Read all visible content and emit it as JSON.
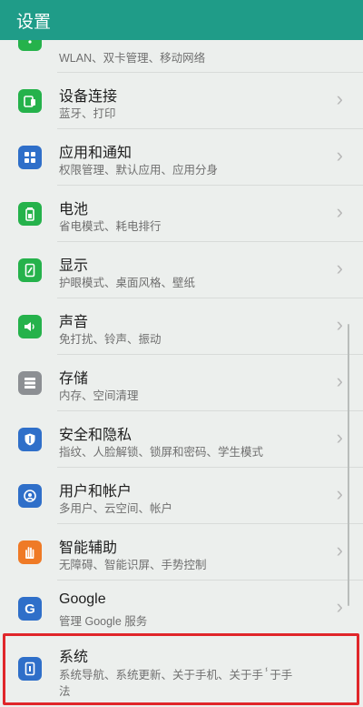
{
  "header": {
    "title": "设置"
  },
  "partial_top": {
    "subtitle": "WLAN、双卡管理、移动网络"
  },
  "items": [
    {
      "title": "设备连接",
      "subtitle": "蓝牙、打印"
    },
    {
      "title": "应用和通知",
      "subtitle": "权限管理、默认应用、应用分身"
    },
    {
      "title": "电池",
      "subtitle": "省电模式、耗电排行"
    },
    {
      "title": "显示",
      "subtitle": "护眼模式、桌面风格、壁纸"
    },
    {
      "title": "声音",
      "subtitle": "免打扰、铃声、振动"
    },
    {
      "title": "存储",
      "subtitle": "内存、空间清理"
    },
    {
      "title": "安全和隐私",
      "subtitle": "指纹、人脸解锁、锁屏和密码、学生模式"
    },
    {
      "title": "用户和帐户",
      "subtitle": "多用户、云空间、帐户"
    },
    {
      "title": "智能辅助",
      "subtitle": "无障碍、智能识屏、手势控制"
    },
    {
      "title": "Google",
      "subtitle": "管理 Google 服务"
    },
    {
      "title": "系统",
      "subtitle": "系统导航、系统更新、关于手机、关于手ⸯ于手",
      "subtitle_line2": "法"
    }
  ],
  "colors": {
    "header_bg": "#1f9c88",
    "highlight_border": "#e0262a",
    "icon_green": "#25b24b",
    "icon_blue": "#2f6fc9",
    "icon_orange": "#ef7a26"
  },
  "icons": [
    "wifi-icon",
    "device-connection-icon",
    "apps-icon",
    "battery-icon",
    "display-icon",
    "sound-icon",
    "storage-icon",
    "security-icon",
    "user-account-icon",
    "assist-hand-icon",
    "google-icon",
    "system-icon",
    "chevron-right-icon"
  ]
}
